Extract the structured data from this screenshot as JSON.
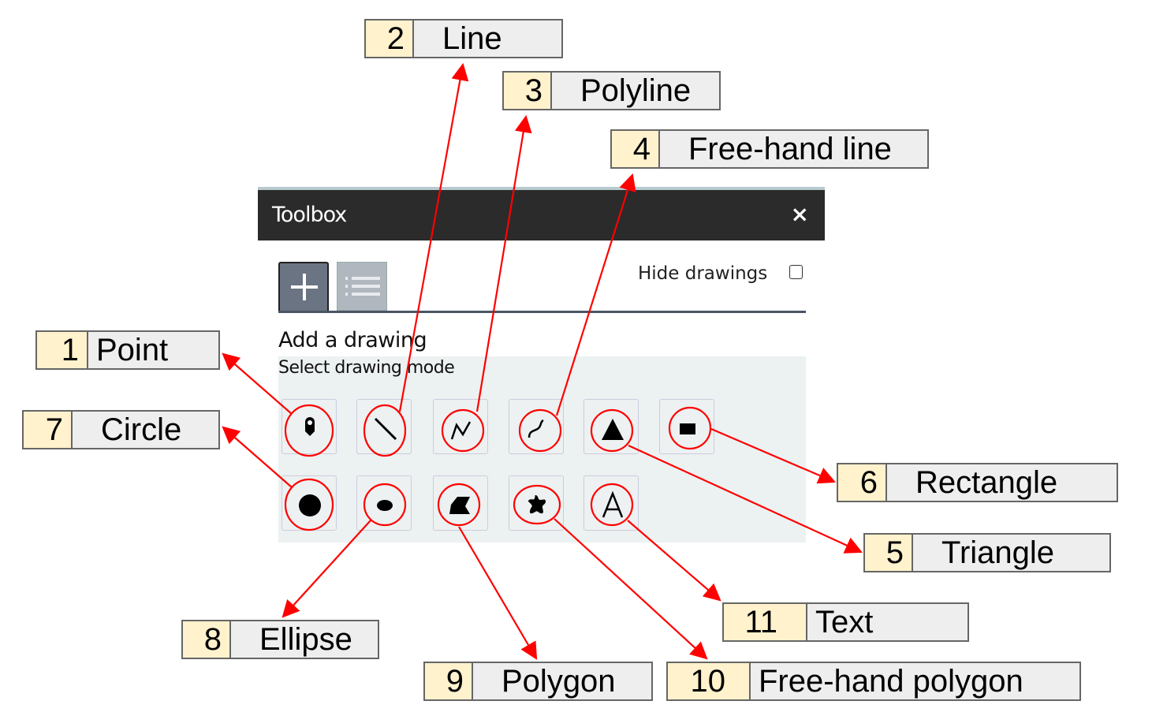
{
  "toolbox": {
    "title": "Toolbox",
    "close_label": "×",
    "tabs": [
      {
        "name": "add",
        "icon": "plus-icon"
      },
      {
        "name": "list",
        "icon": "list-icon"
      }
    ],
    "hide_drawings_label": "Hide drawings",
    "hide_drawings_checked": false,
    "heading": "Add a drawing",
    "subheading": "Select drawing mode",
    "tools": [
      {
        "id": "point",
        "icon": "map-pin-icon"
      },
      {
        "id": "line",
        "icon": "line-icon"
      },
      {
        "id": "polyline",
        "icon": "polyline-icon"
      },
      {
        "id": "freehand-line",
        "icon": "freehand-line-icon"
      },
      {
        "id": "triangle",
        "icon": "triangle-icon"
      },
      {
        "id": "rectangle",
        "icon": "rectangle-icon"
      },
      {
        "id": "circle",
        "icon": "circle-icon"
      },
      {
        "id": "ellipse",
        "icon": "ellipse-icon"
      },
      {
        "id": "polygon",
        "icon": "polygon-icon"
      },
      {
        "id": "freehand-polygon",
        "icon": "freehand-polygon-icon"
      },
      {
        "id": "text",
        "icon": "text-icon"
      }
    ]
  },
  "callouts": [
    {
      "number": "1",
      "label": "Point"
    },
    {
      "number": "2",
      "label": "Line"
    },
    {
      "number": "3",
      "label": "Polyline"
    },
    {
      "number": "4",
      "label": "Free-hand line"
    },
    {
      "number": "5",
      "label": "Triangle"
    },
    {
      "number": "6",
      "label": "Rectangle"
    },
    {
      "number": "7",
      "label": "Circle"
    },
    {
      "number": "8",
      "label": "Ellipse"
    },
    {
      "number": "9",
      "label": "Polygon"
    },
    {
      "number": "10",
      "label": "Free-hand polygon"
    },
    {
      "number": "11",
      "label": "Text"
    }
  ],
  "colors": {
    "annotation": "#ff0000",
    "callout_number_bg": "#fff2cc",
    "callout_label_bg": "#eeeeee",
    "header_bg": "#2b2b2b"
  }
}
